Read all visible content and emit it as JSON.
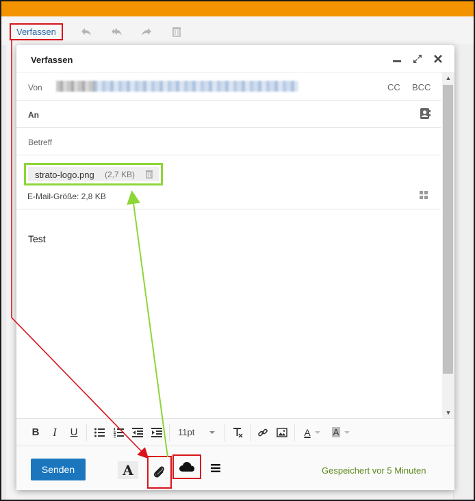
{
  "app": {
    "accent_color": "#f39300",
    "toolbar": {
      "compose_label": "Verfassen",
      "icons": [
        "reply-icon",
        "reply-all-icon",
        "forward-icon",
        "trash-icon"
      ]
    }
  },
  "compose": {
    "title": "Verfassen",
    "window_controls": [
      "minimize-icon",
      "expand-icon",
      "close-icon"
    ],
    "from": {
      "label": "Von",
      "address_blurred": true,
      "cc_label": "CC",
      "bcc_label": "BCC"
    },
    "to": {
      "label": "An",
      "icon": "contacts-icon"
    },
    "subject": {
      "label": "Betreff",
      "value": ""
    },
    "attachment": {
      "filename": "strato-logo.png",
      "size": "(2,7 KB)",
      "icon": "trash-icon"
    },
    "mail_size": "E-Mail-Größe: 2,8 KB",
    "body_text": "Test",
    "format_bar": {
      "buttons": [
        "bold-icon",
        "italic-icon",
        "underline-icon",
        "bullet-list-icon",
        "numbered-list-icon",
        "outdent-icon",
        "indent-icon",
        "clear-format-icon",
        "link-icon",
        "image-icon",
        "font-color-icon",
        "bg-color-icon"
      ],
      "bold": "B",
      "italic": "I",
      "underline": "U",
      "font_size": "11pt",
      "font_color_letter": "A",
      "bg_color_letter": "A"
    },
    "footer": {
      "send_label": "Senden",
      "text_format_letter": "A",
      "saved_status": "Gespeichert vor 5 Minuten",
      "saved_color": "#5d8a1c",
      "send_color": "#1b76be"
    }
  },
  "annotations": {
    "red_color": "#d9141b",
    "green_color": "#8cd637"
  }
}
